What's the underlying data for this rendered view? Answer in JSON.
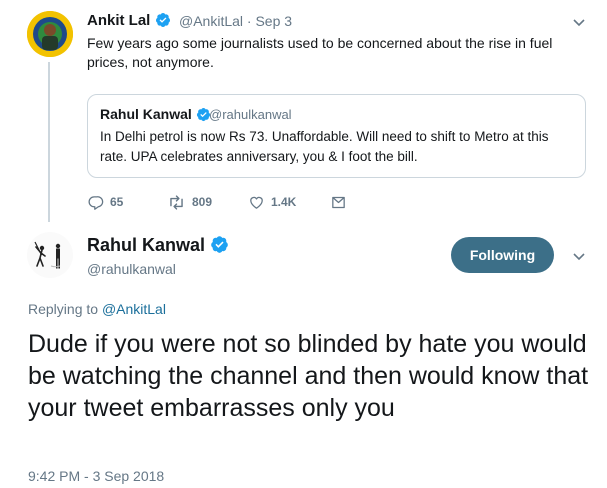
{
  "parent_tweet": {
    "name": "Ankit Lal",
    "handle": "@AnkitLal · Sep 3",
    "text": "Few years ago some journalists used to be concerned about the rise in fuel prices, not anymore.",
    "quoted": {
      "name": "Rahul Kanwal",
      "handle": "@rahulkanwal",
      "text": "In Delhi petrol is now Rs 73. Unaffordable. Will need to shift to Metro at this rate. UPA celebrates anniversary, you & I foot the bill."
    },
    "actions": {
      "replies": "65",
      "retweets": "809",
      "likes": "1.4K"
    }
  },
  "main_tweet": {
    "name": "Rahul Kanwal",
    "handle": "@rahulkanwal",
    "follow_label": "Following",
    "replying_prefix": "Replying to",
    "replying_mention": "@AnkitLal",
    "text": "Dude if you were not so blinded by hate you would be watching the channel and then would know that your tweet embarrasses only you",
    "timestamp": "9:42 PM - 3 Sep 2018"
  },
  "colors": {
    "verified_blue": "#1da1f2",
    "following_button": "#3c6f88",
    "secondary_text": "#657786",
    "mention_link": "#1b6f9b"
  },
  "icons": [
    "verified-badge-icon",
    "chevron-down-icon",
    "reply-icon",
    "retweet-icon",
    "like-icon",
    "direct-message-icon"
  ]
}
